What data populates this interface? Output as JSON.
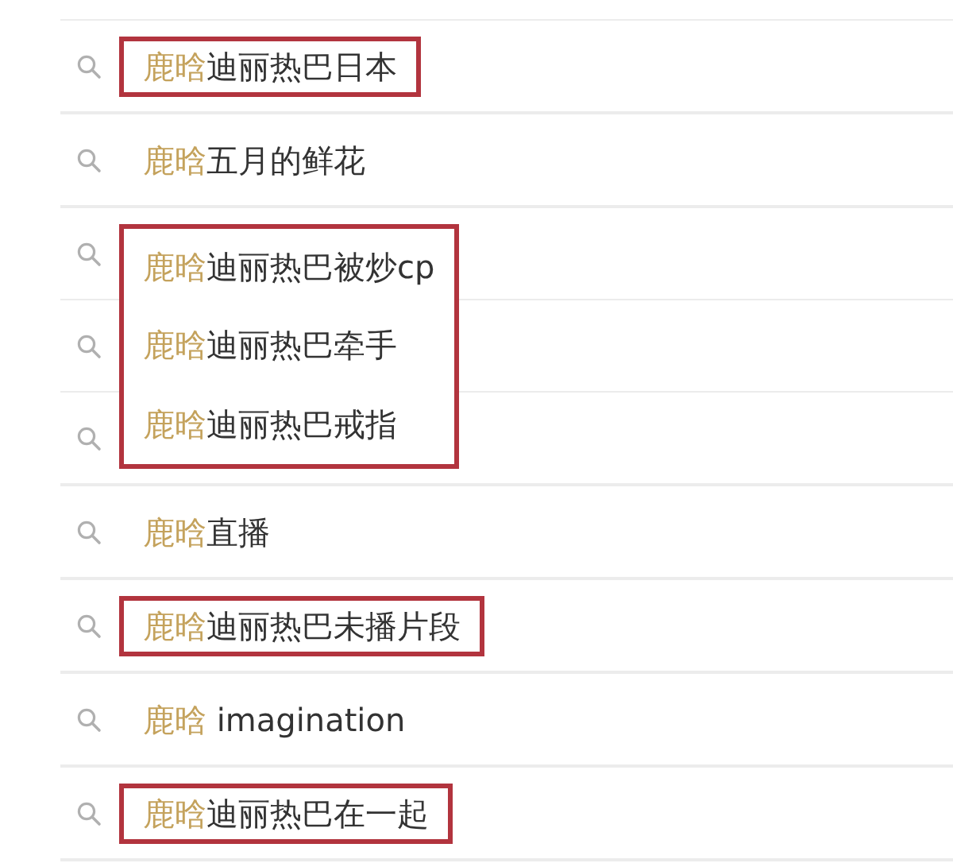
{
  "groups": [
    {
      "boxed": true,
      "items": [
        {
          "prefix": "鹿晗",
          "rest": "迪丽热巴日本"
        }
      ]
    },
    {
      "boxed": false,
      "items": [
        {
          "prefix": "鹿晗",
          "rest": "五月的鲜花"
        }
      ]
    },
    {
      "boxed": true,
      "items": [
        {
          "prefix": "鹿晗",
          "rest": "迪丽热巴被炒cp"
        },
        {
          "prefix": "鹿晗",
          "rest": "迪丽热巴牵手"
        },
        {
          "prefix": "鹿晗",
          "rest": "迪丽热巴戒指"
        }
      ]
    },
    {
      "boxed": false,
      "items": [
        {
          "prefix": "鹿晗",
          "rest": "直播"
        }
      ]
    },
    {
      "boxed": true,
      "items": [
        {
          "prefix": "鹿晗",
          "rest": "迪丽热巴未播片段"
        }
      ]
    },
    {
      "boxed": false,
      "items": [
        {
          "prefix": "鹿晗",
          "rest": " imagination"
        }
      ]
    },
    {
      "boxed": true,
      "items": [
        {
          "prefix": "鹿晗",
          "rest": "迪丽热巴在一起"
        }
      ]
    }
  ]
}
